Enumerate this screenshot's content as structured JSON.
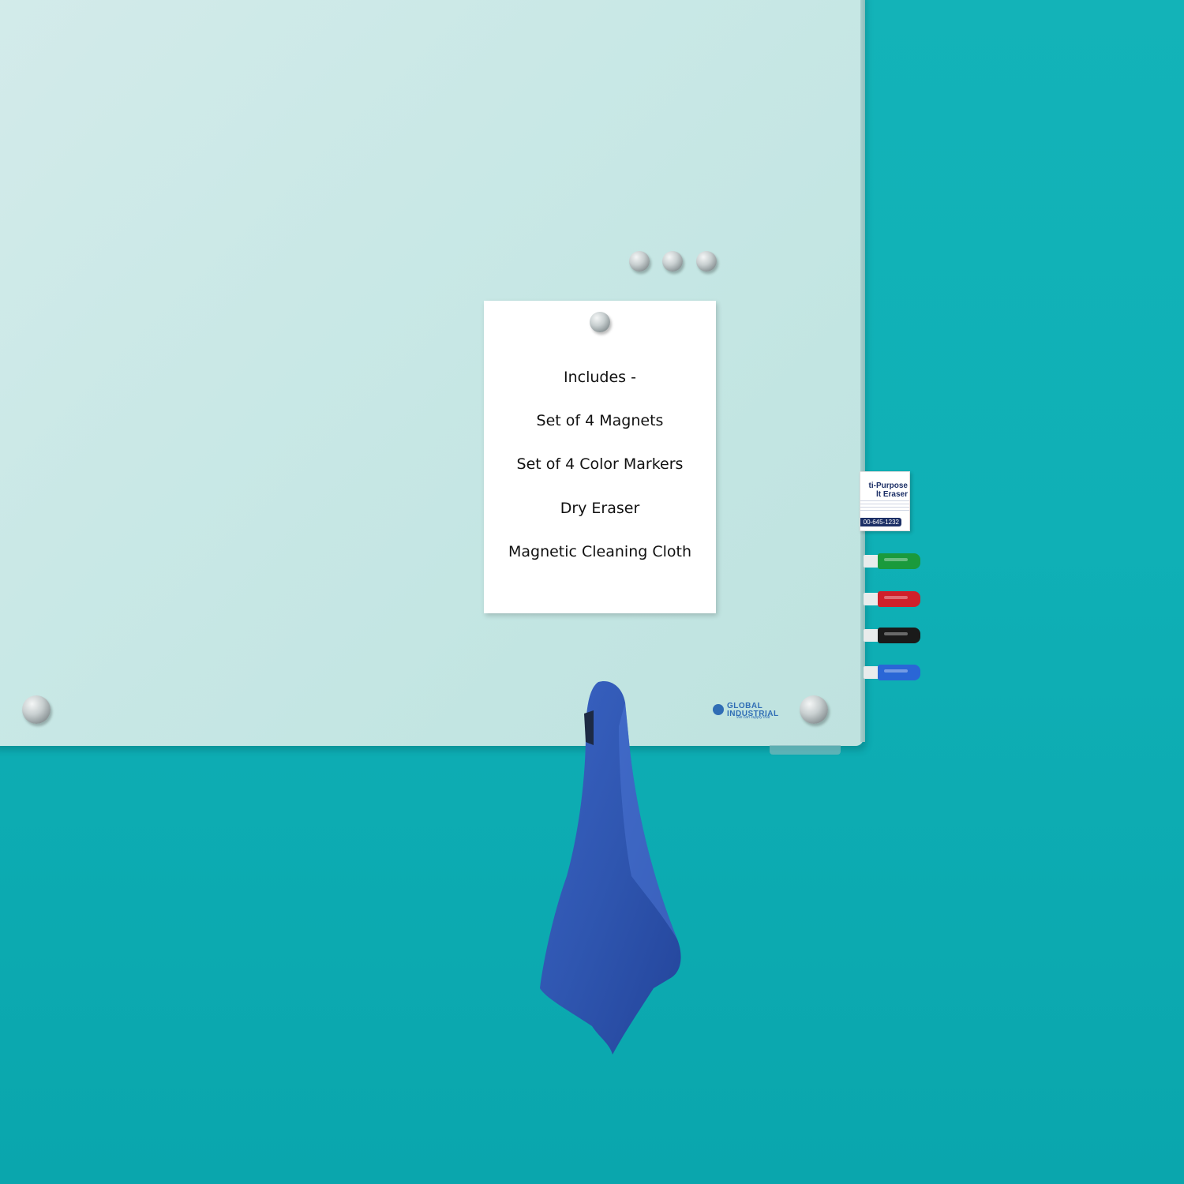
{
  "card": {
    "lines": [
      "Includes -",
      "Set of 4 Magnets",
      "Set of 4 Color Markers",
      "Dry Eraser",
      "Magnetic Cleaning Cloth"
    ]
  },
  "logo": {
    "name": "GLOBAL",
    "name2": "INDUSTRIAL",
    "tagline": "We can supply that"
  },
  "eraser_label": {
    "title1": "ti-Purpose",
    "title2": "lt Eraser",
    "phone": "00-645-1232"
  },
  "markers": [
    {
      "color": "green",
      "hex": "#1a9a3c"
    },
    {
      "color": "red",
      "hex": "#d0202a"
    },
    {
      "color": "black",
      "hex": "#1a1a1a"
    },
    {
      "color": "blue",
      "hex": "#2a66d6"
    }
  ],
  "colors": {
    "wall": "#0fb0b6",
    "board": "#c9e8e6",
    "cloth": "#2f56b0"
  }
}
